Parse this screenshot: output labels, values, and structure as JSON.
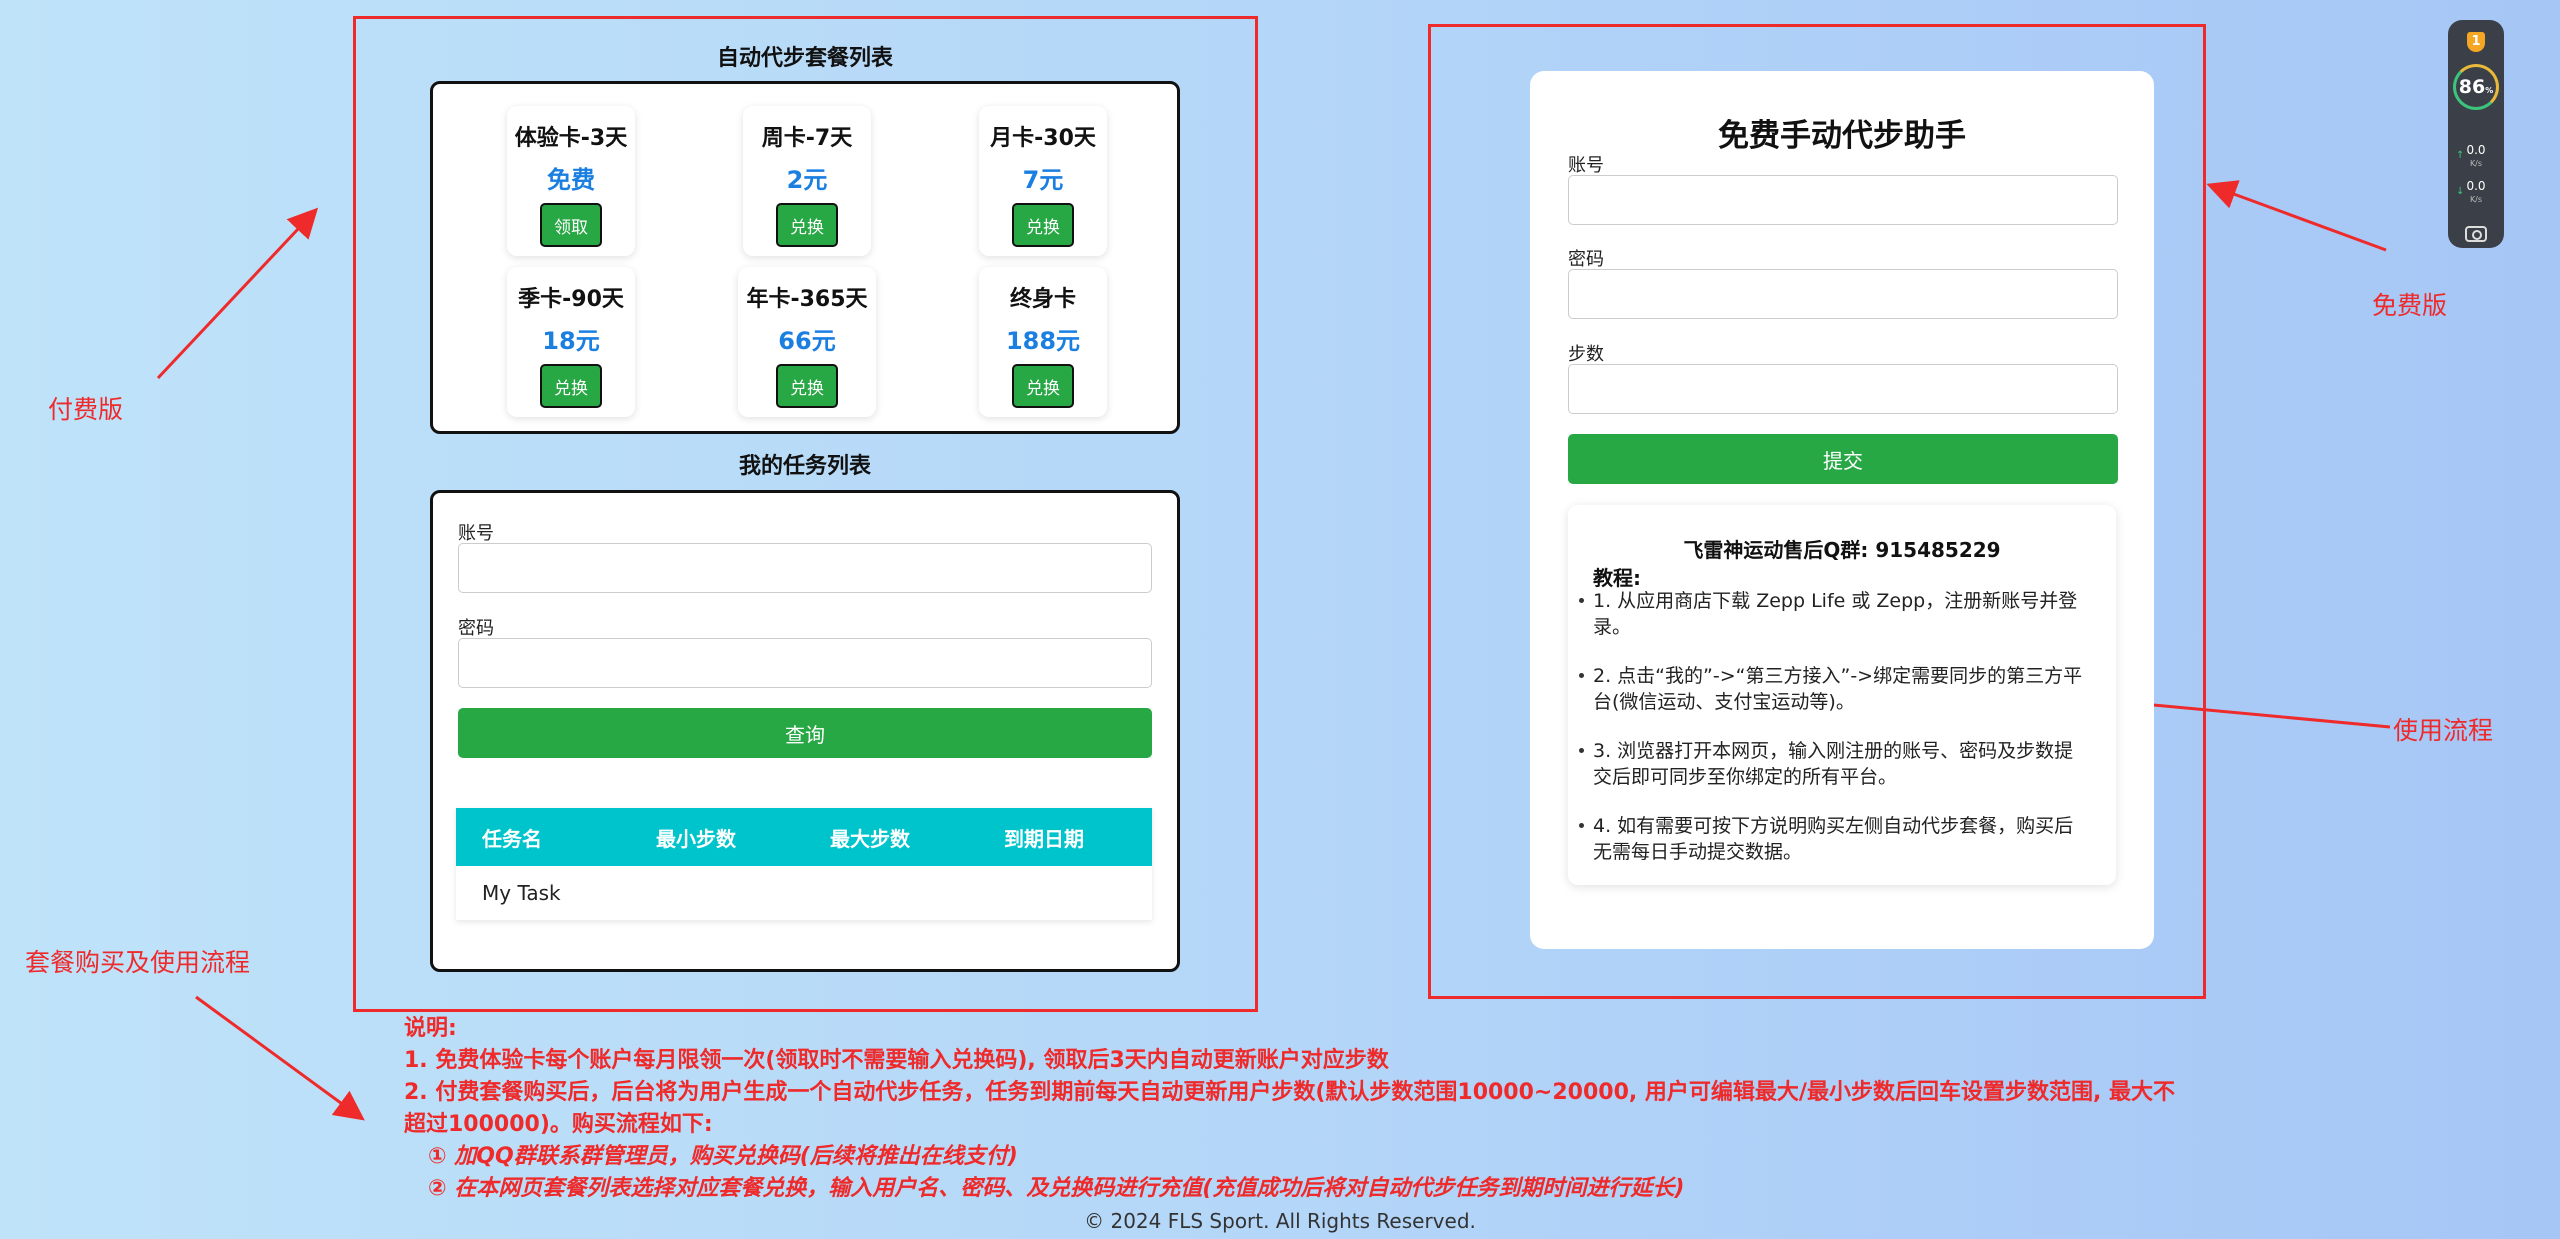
{
  "annotations": {
    "paid": "付费版",
    "free": "免费版",
    "usage_flow": "使用流程",
    "purchase_flow": "套餐购买及使用流程",
    "colors": {
      "annotation": "#ee2a2a"
    }
  },
  "packages_section": {
    "title": "自动代步套餐列表",
    "packages": [
      {
        "name": "体验卡-3天",
        "price": "免费",
        "button": "领取"
      },
      {
        "name": "周卡-7天",
        "price": "2元",
        "button": "兑换"
      },
      {
        "name": "月卡-30天",
        "price": "7元",
        "button": "兑换"
      },
      {
        "name": "季卡-90天",
        "price": "18元",
        "button": "兑换"
      },
      {
        "name": "年卡-365天",
        "price": "66元",
        "button": "兑换"
      },
      {
        "name": "终身卡",
        "price": "188元",
        "button": "兑换"
      }
    ],
    "colors": {
      "price": "#1a7fe0",
      "button": "#28a745"
    }
  },
  "tasks_section": {
    "title": "我的任务列表",
    "account_label": "账号",
    "password_label": "密码",
    "query_button": "查询",
    "table": {
      "headers": [
        "任务名",
        "最小步数",
        "最大步数",
        "到期日期"
      ],
      "rows": [
        [
          "My Task",
          "",
          "",
          ""
        ]
      ]
    },
    "colors": {
      "header": "#00c4cc"
    }
  },
  "free_section": {
    "title": "免费手动代步助手",
    "account_label": "账号",
    "password_label": "密码",
    "steps_label": "步数",
    "submit_button": "提交",
    "guide": {
      "qq": "飞雷神运动售后Q群: 915485229",
      "heading": "教程:",
      "steps": [
        "1. 从应用商店下载 Zepp Life 或 Zepp，注册新账号并登录。",
        "2. 点击“我的”->“第三方接入”->绑定需要同步的第三方平台(微信运动、支付宝运动等)。",
        "3. 浏览器打开本网页，输入刚注册的账号、密码及步数提交后即可同步至你绑定的所有平台。",
        "4. 如有需要可按下方说明购买左侧自动代步套餐，购买后无需每日手动提交数据。"
      ]
    }
  },
  "notes": {
    "title": "说明:",
    "item1": "1. 免费体验卡每个账户每月限领一次(领取时不需要输入兑换码), 领取后3天内自动更新账户对应步数",
    "item2": "2. 付费套餐购买后，后台将为用户生成一个自动代步任务，任务到期前每天自动更新用户步数(默认步数范围10000~20000, 用户可编辑最大/最小步数后回车设置步数范围, 最大不超过100000)。购买流程如下:",
    "step1": "① 加QQ群联系群管理员，购买兑换码(后续将推出在线支付)",
    "step2": "② 在本网页套餐列表选择对应套餐兑换，输入用户名、密码、及兑换码进行充值(充值成功后将对自动代步任务到期时间进行延长)"
  },
  "footer": "© 2024 FLS Sport. All Rights Reserved.",
  "widget": {
    "badge": "1",
    "cpu": "86",
    "cpu_unit": "%",
    "up": "0.0",
    "down": "0.0",
    "unit": "K/s",
    "icons": [
      "shield-icon",
      "upload-arrow-icon",
      "download-arrow-icon",
      "camera-icon"
    ]
  }
}
